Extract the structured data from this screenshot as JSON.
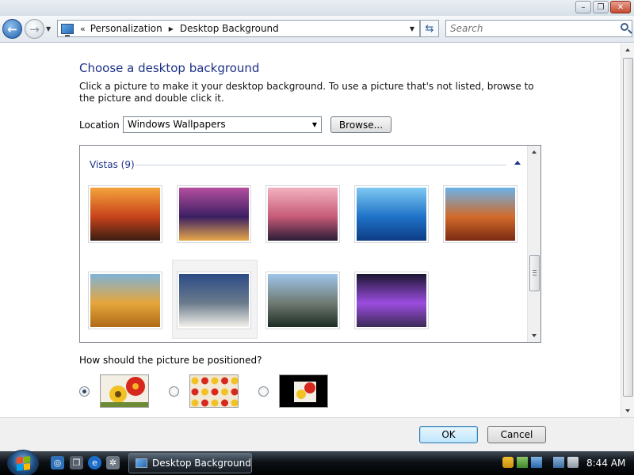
{
  "window": {
    "controls": {
      "minimize": "–",
      "maximize": "❐",
      "close": "✕"
    }
  },
  "address_bar": {
    "back_glyph": "←",
    "forward_glyph": "→",
    "crumb_prefix": "«",
    "breadcrumbs": [
      "Personalization",
      "Desktop Background"
    ],
    "refresh_glyph": "⇆",
    "search_placeholder": "Search"
  },
  "page": {
    "heading": "Choose a desktop background",
    "description": "Click a picture to make it your desktop background. To use a picture that's not listed, browse to the picture and double click it.",
    "location_label": "Location",
    "location_value": "Windows Wallpapers",
    "browse_label": "Browse...",
    "group_title": "Vistas (9)",
    "thumbnails": [
      {
        "name": "canyon-sunset",
        "colors": [
          "#f4a33c",
          "#c8431b",
          "#3a1d12"
        ]
      },
      {
        "name": "bridge-night",
        "colors": [
          "#b64fa0",
          "#3b1f62",
          "#e7a84a"
        ]
      },
      {
        "name": "rock-sunset",
        "colors": [
          "#f3b2c0",
          "#c65a77",
          "#2a1d36"
        ]
      },
      {
        "name": "ocean-pier",
        "colors": [
          "#7ec9f2",
          "#1f72c8",
          "#0d3c84"
        ]
      },
      {
        "name": "rock-arch",
        "colors": [
          "#6bb2ea",
          "#d26a2a",
          "#7a2a12"
        ]
      },
      {
        "name": "dunes",
        "colors": [
          "#7fb3d8",
          "#e5a63c",
          "#b06a16"
        ]
      },
      {
        "name": "mountain-lake",
        "colors": [
          "#2c4b86",
          "#6b7b8c",
          "#f2f0ea"
        ]
      },
      {
        "name": "cliffs",
        "colors": [
          "#9fc6ea",
          "#6f7a72",
          "#1d2c22"
        ]
      },
      {
        "name": "purple-light",
        "colors": [
          "#1b1630",
          "#9c4de0",
          "#3b2a55"
        ]
      }
    ],
    "selected_index": 6,
    "position_question": "How should the picture be positioned?",
    "position_options": [
      "fit-to-screen",
      "tile",
      "center"
    ],
    "position_selected": 0
  },
  "footer": {
    "ok_label": "OK",
    "cancel_label": "Cancel"
  },
  "taskbar": {
    "task_label": "Desktop Background",
    "clock": "8:44 AM"
  }
}
